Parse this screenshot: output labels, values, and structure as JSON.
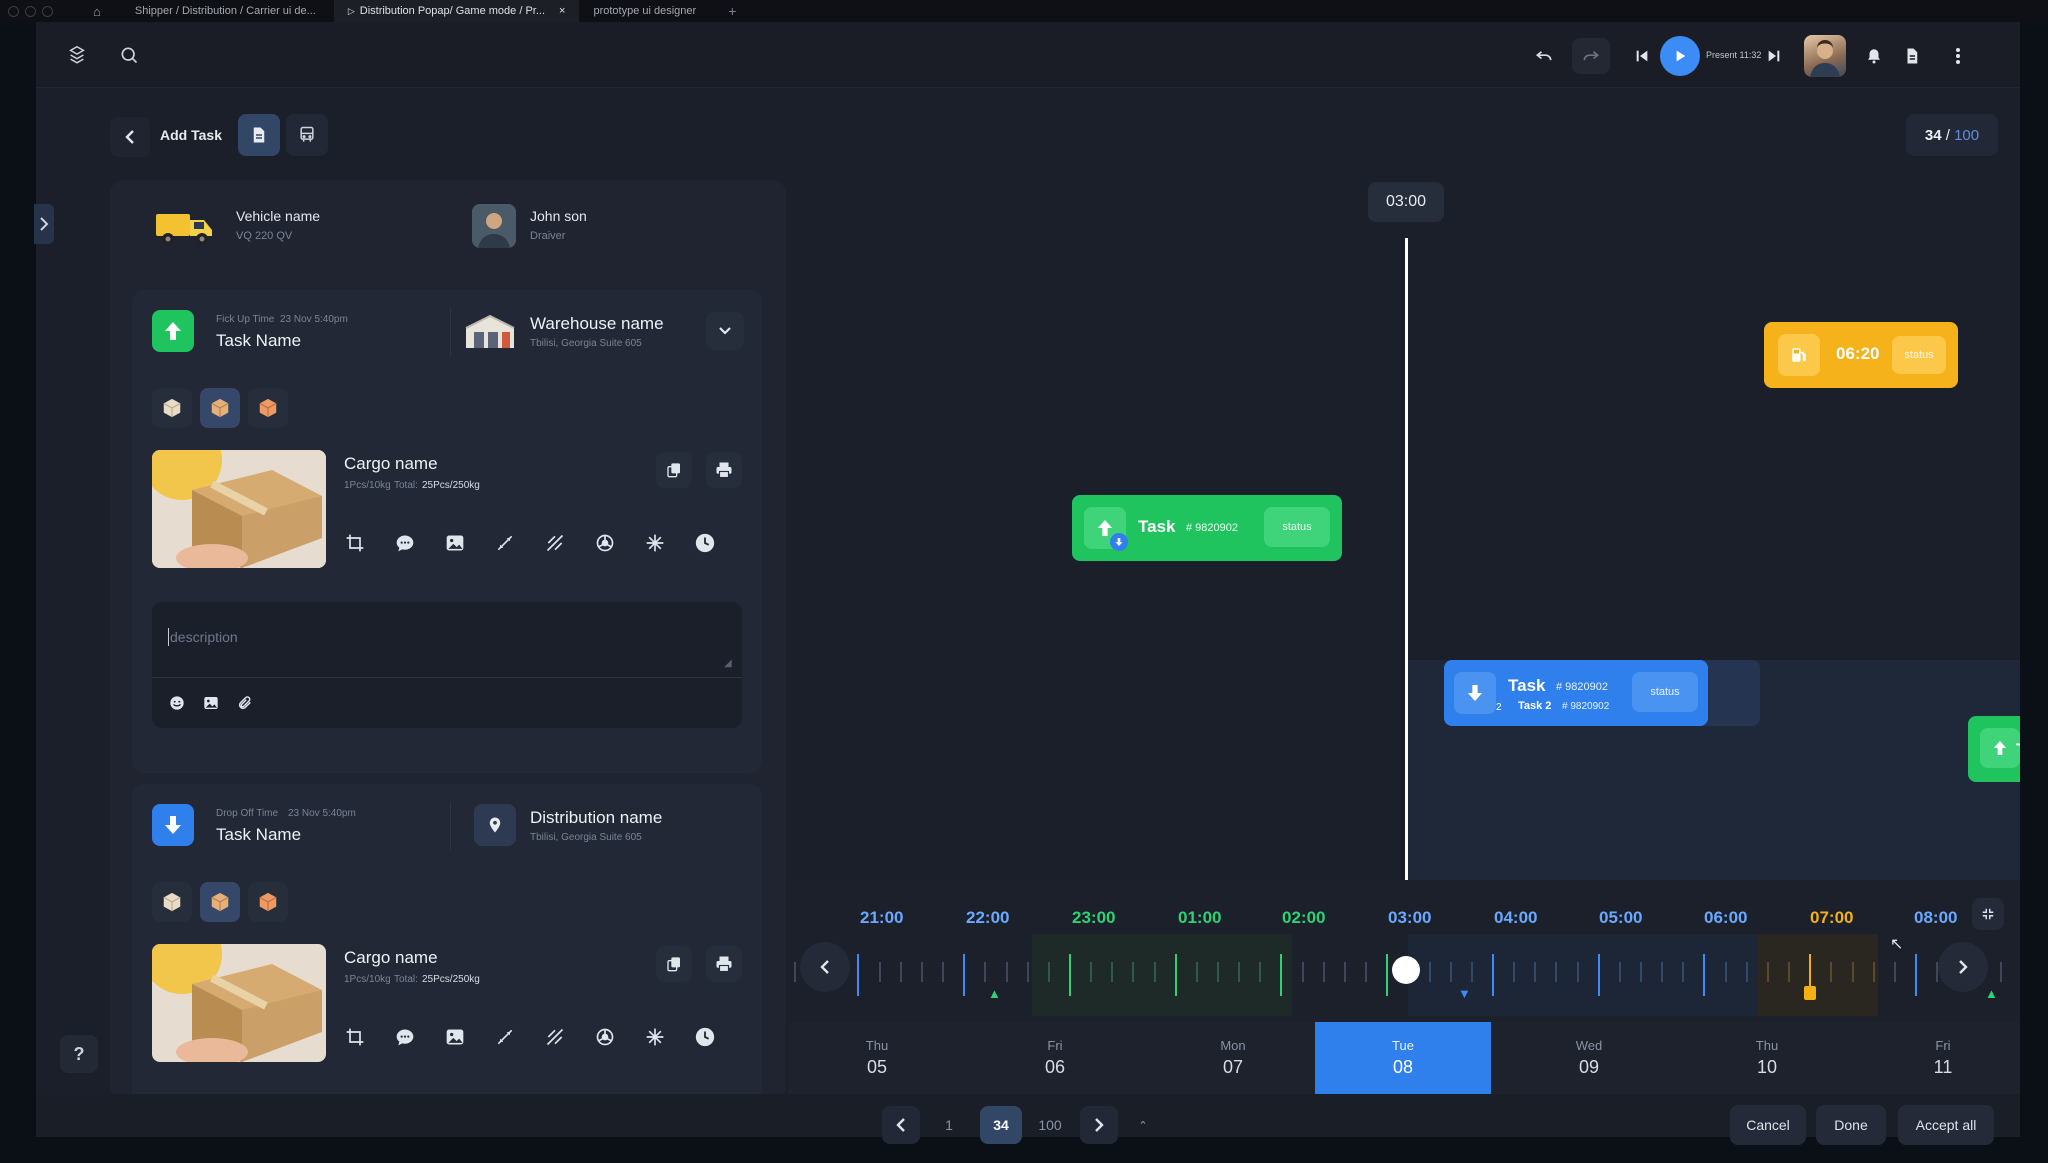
{
  "browser": {
    "tabs": [
      {
        "label": "Shipper / Distribution / Carrier ui de..."
      },
      {
        "label": "Distribution Popap/ Game mode / Pr..."
      },
      {
        "label": "prototype ui designer"
      }
    ]
  },
  "topbar": {
    "present_label": "Present 11:32"
  },
  "header": {
    "add_task": "Add Task",
    "page_current": "34",
    "page_sep": " / ",
    "page_total": "100"
  },
  "vehicle": {
    "name": "Vehicle name",
    "plate": "VQ 220 QV"
  },
  "driver": {
    "name": "John son",
    "role": "Draiver"
  },
  "pickup": {
    "time_label": "Fick Up Time",
    "time_value": "23 Nov 5:40pm",
    "task_name": "Task Name",
    "location_name": "Warehouse name",
    "location_addr": "Tbilisi, Georgia Suite 605",
    "cargo_name": "Cargo name",
    "cargo_unit": "1Pcs/10kg",
    "cargo_total_label": "Total:",
    "cargo_total": "25Pcs/250kg",
    "description_placeholder": "description"
  },
  "dropoff": {
    "time_label": "Drop Off Time",
    "time_value": "23 Nov 5:40pm",
    "task_name": "Task Name",
    "location_name": "Distribution name",
    "location_addr": "Tbilisi, Georgia Suite 605",
    "cargo_name": "Cargo name",
    "cargo_unit": "1Pcs/10kg",
    "cargo_total_label": "Total:",
    "cargo_total": "25Pcs/250kg"
  },
  "timeline": {
    "current_time": "03:00",
    "fuel_card": {
      "time": "06:20",
      "status": "status"
    },
    "task_card_1": {
      "label": "Task",
      "number": "# 9820902",
      "status": "status"
    },
    "task_card_2": {
      "label": "Task",
      "number": "# 9820902",
      "sub_label": "Task 2",
      "sub_number": "# 9820902",
      "count": "2",
      "status": "status"
    },
    "task_card_3": {
      "label": "Ta"
    },
    "hours": [
      "21:00",
      "22:00",
      "23:00",
      "01:00",
      "02:00",
      "03:00",
      "04:00",
      "05:00",
      "06:00",
      "07:00",
      "08:00"
    ],
    "days": [
      {
        "name": "Thu",
        "num": "05"
      },
      {
        "name": "Fri",
        "num": "06"
      },
      {
        "name": "Mon",
        "num": "07"
      },
      {
        "name": "Tue",
        "num": "08"
      },
      {
        "name": "Wed",
        "num": "09"
      },
      {
        "name": "Thu",
        "num": "10"
      },
      {
        "name": "Fri",
        "num": "11"
      }
    ]
  },
  "pagination": {
    "first": "1",
    "current": "34",
    "last": "100"
  },
  "actions": {
    "cancel": "Cancel",
    "done": "Done",
    "accept_all": "Accept all"
  },
  "help": "?",
  "colors": {
    "green": "#22c55e",
    "blue": "#2f80ed",
    "orange": "#f5b014",
    "panel": "#1f2430"
  }
}
